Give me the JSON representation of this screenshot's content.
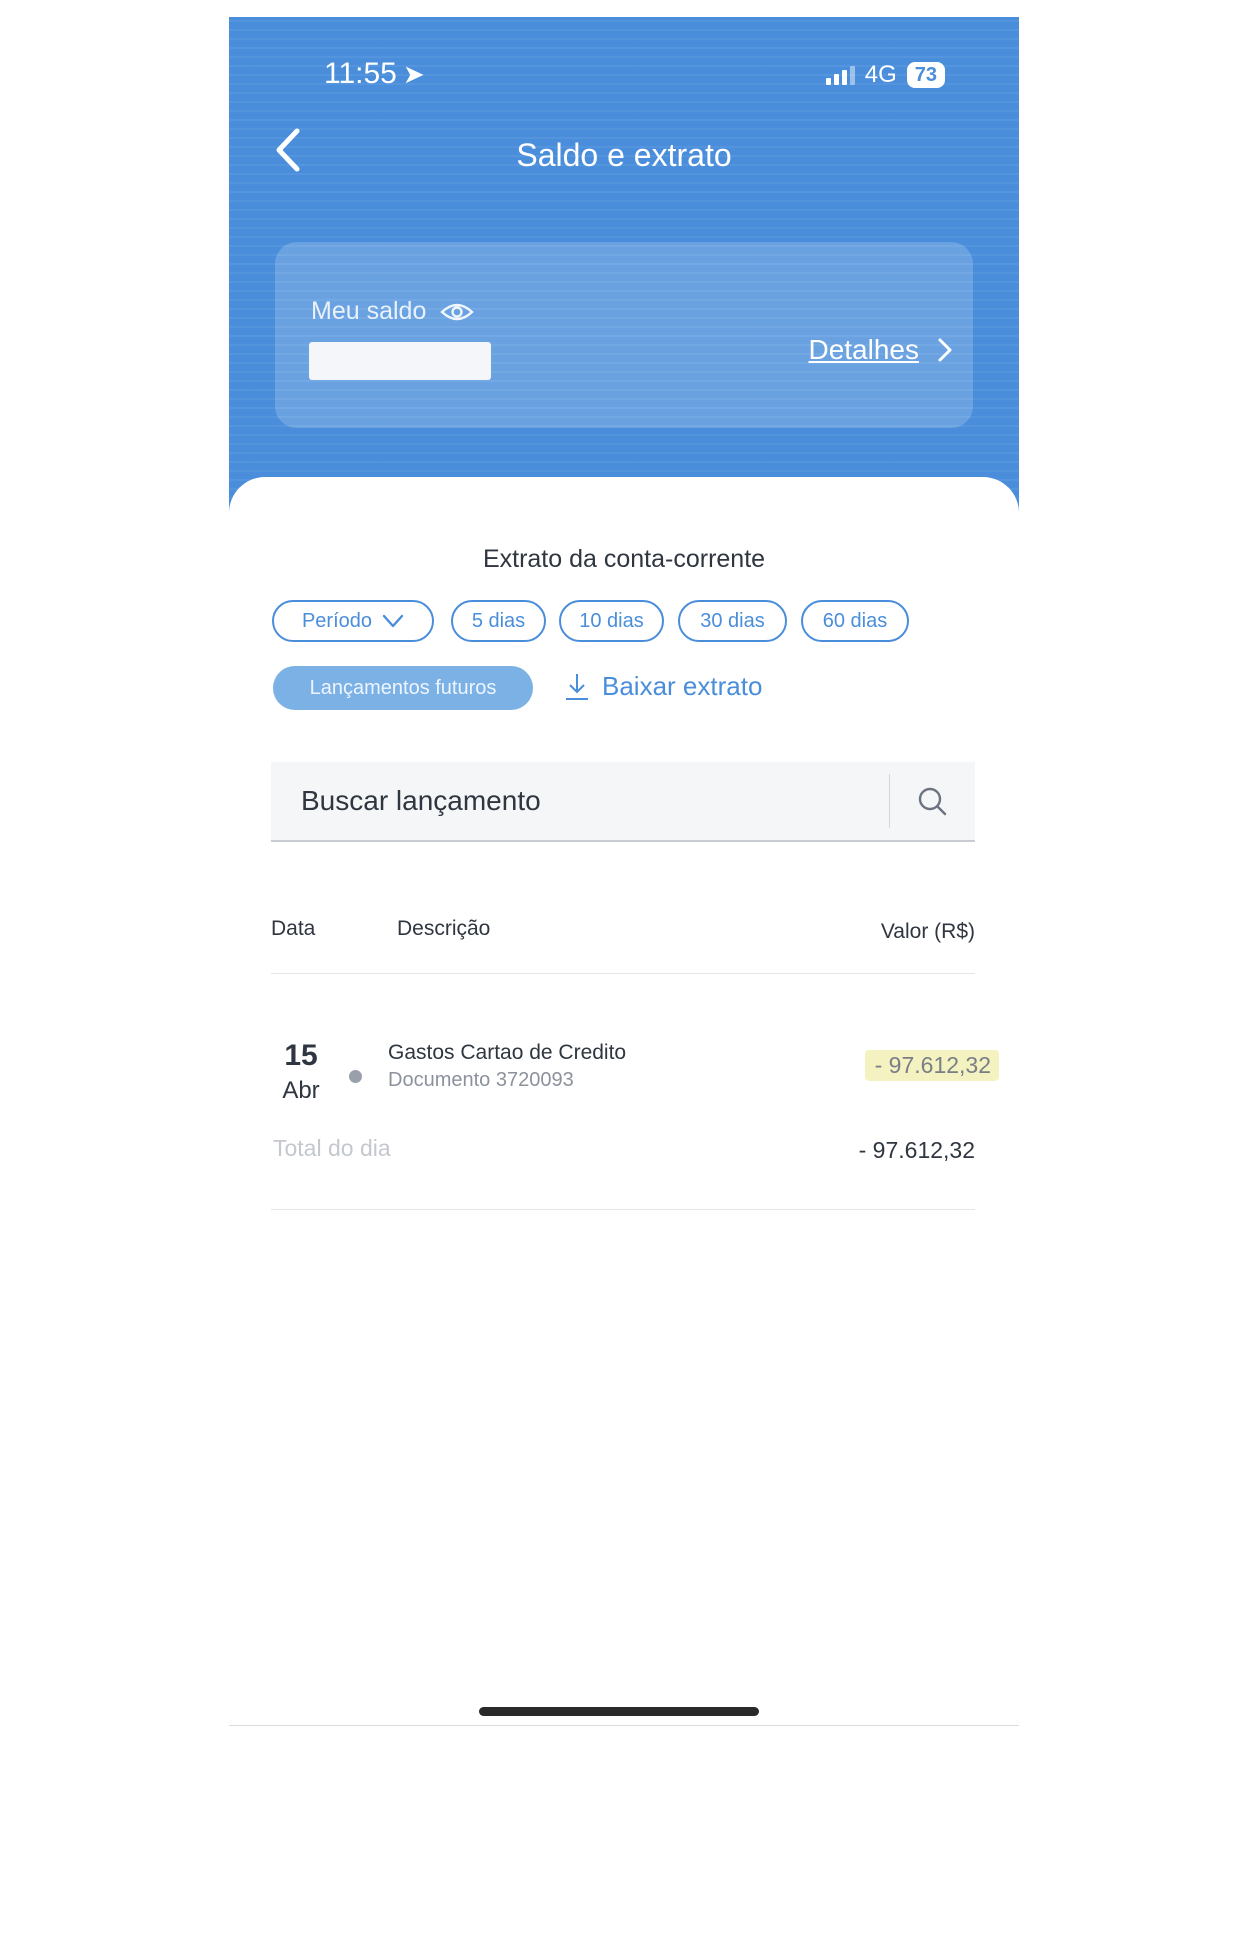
{
  "status_bar": {
    "time": "11:55",
    "network": "4G",
    "battery": "73"
  },
  "header": {
    "title": "Saldo e extrato"
  },
  "balance": {
    "label": "Meu saldo",
    "details_label": "Detalhes"
  },
  "statement": {
    "title": "Extrato da conta-corrente",
    "period_label": "Período",
    "filters": [
      "5 dias",
      "10 dias",
      "30 dias",
      "60 dias"
    ],
    "future_label": "Lançamentos futuros",
    "download_label": "Baixar extrato"
  },
  "search": {
    "placeholder": "Buscar lançamento"
  },
  "table": {
    "headers": {
      "date": "Data",
      "description": "Descrição",
      "value": "Valor (R$)"
    },
    "transactions": [
      {
        "day": "15",
        "month": "Abr",
        "title": "Gastos Cartao de Credito",
        "document": "Documento 3720093",
        "amount": "- 97.612,32"
      }
    ],
    "total_label": "Total do dia",
    "total_amount": "- 97.612,32"
  },
  "colors": {
    "primary": "#4a8edb",
    "chip_filled": "#7cb1e6",
    "highlight": "#f4f2c0"
  },
  "icons": {
    "back": "chevron-left-icon",
    "location": "location-arrow-icon",
    "signal": "signal-bars-icon",
    "eye": "eye-icon",
    "details": "chevron-right-icon",
    "period": "chevron-down-icon",
    "download": "download-icon",
    "search": "search-icon"
  }
}
